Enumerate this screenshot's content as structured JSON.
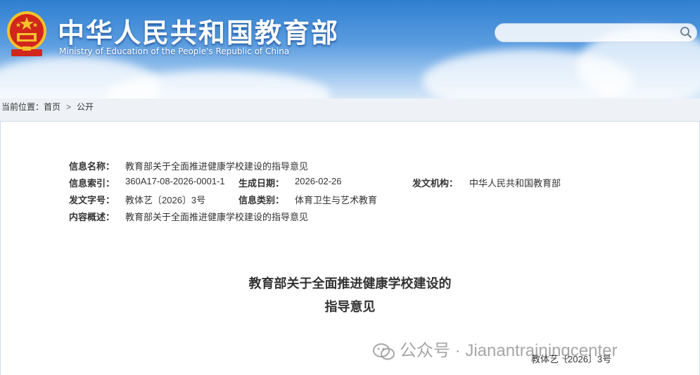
{
  "header": {
    "title": "中华人民共和国教育部",
    "subtitle": "Ministry of Education of the People's Republic of China",
    "search_placeholder": ""
  },
  "breadcrumb": {
    "prefix": "当前位置：",
    "home": "首页",
    "separator": ">",
    "current": "公开"
  },
  "info": {
    "name_label": "信息名称：",
    "name_value": "教育部关于全面推进健康学校建设的指导意见",
    "index_label": "信息索引：",
    "index_value": "360A17-08-2026-0001-1",
    "date_label": "生成日期：",
    "date_value": "2026-02-26",
    "issuer_label": "发文机构：",
    "issuer_value": "中华人民共和国教育部",
    "docno_label": "发文字号：",
    "docno_value": "教体艺〔2026〕3号",
    "category_label": "信息类别：",
    "category_value": "体育卫生与艺术教育",
    "summary_label": "内容概述：",
    "summary_value": "教育部关于全面推进健康学校建设的指导意见"
  },
  "document": {
    "title_line1": "教育部关于全面推进健康学校建设的",
    "title_line2": "指导意见",
    "number": "教体艺〔2026〕3号"
  },
  "watermark": {
    "text": "公众号 · Jianantrainingcenter"
  },
  "colors": {
    "header_blue": "#2f7fd0",
    "emblem_red": "#d1261c",
    "emblem_gold": "#f4c22b"
  }
}
